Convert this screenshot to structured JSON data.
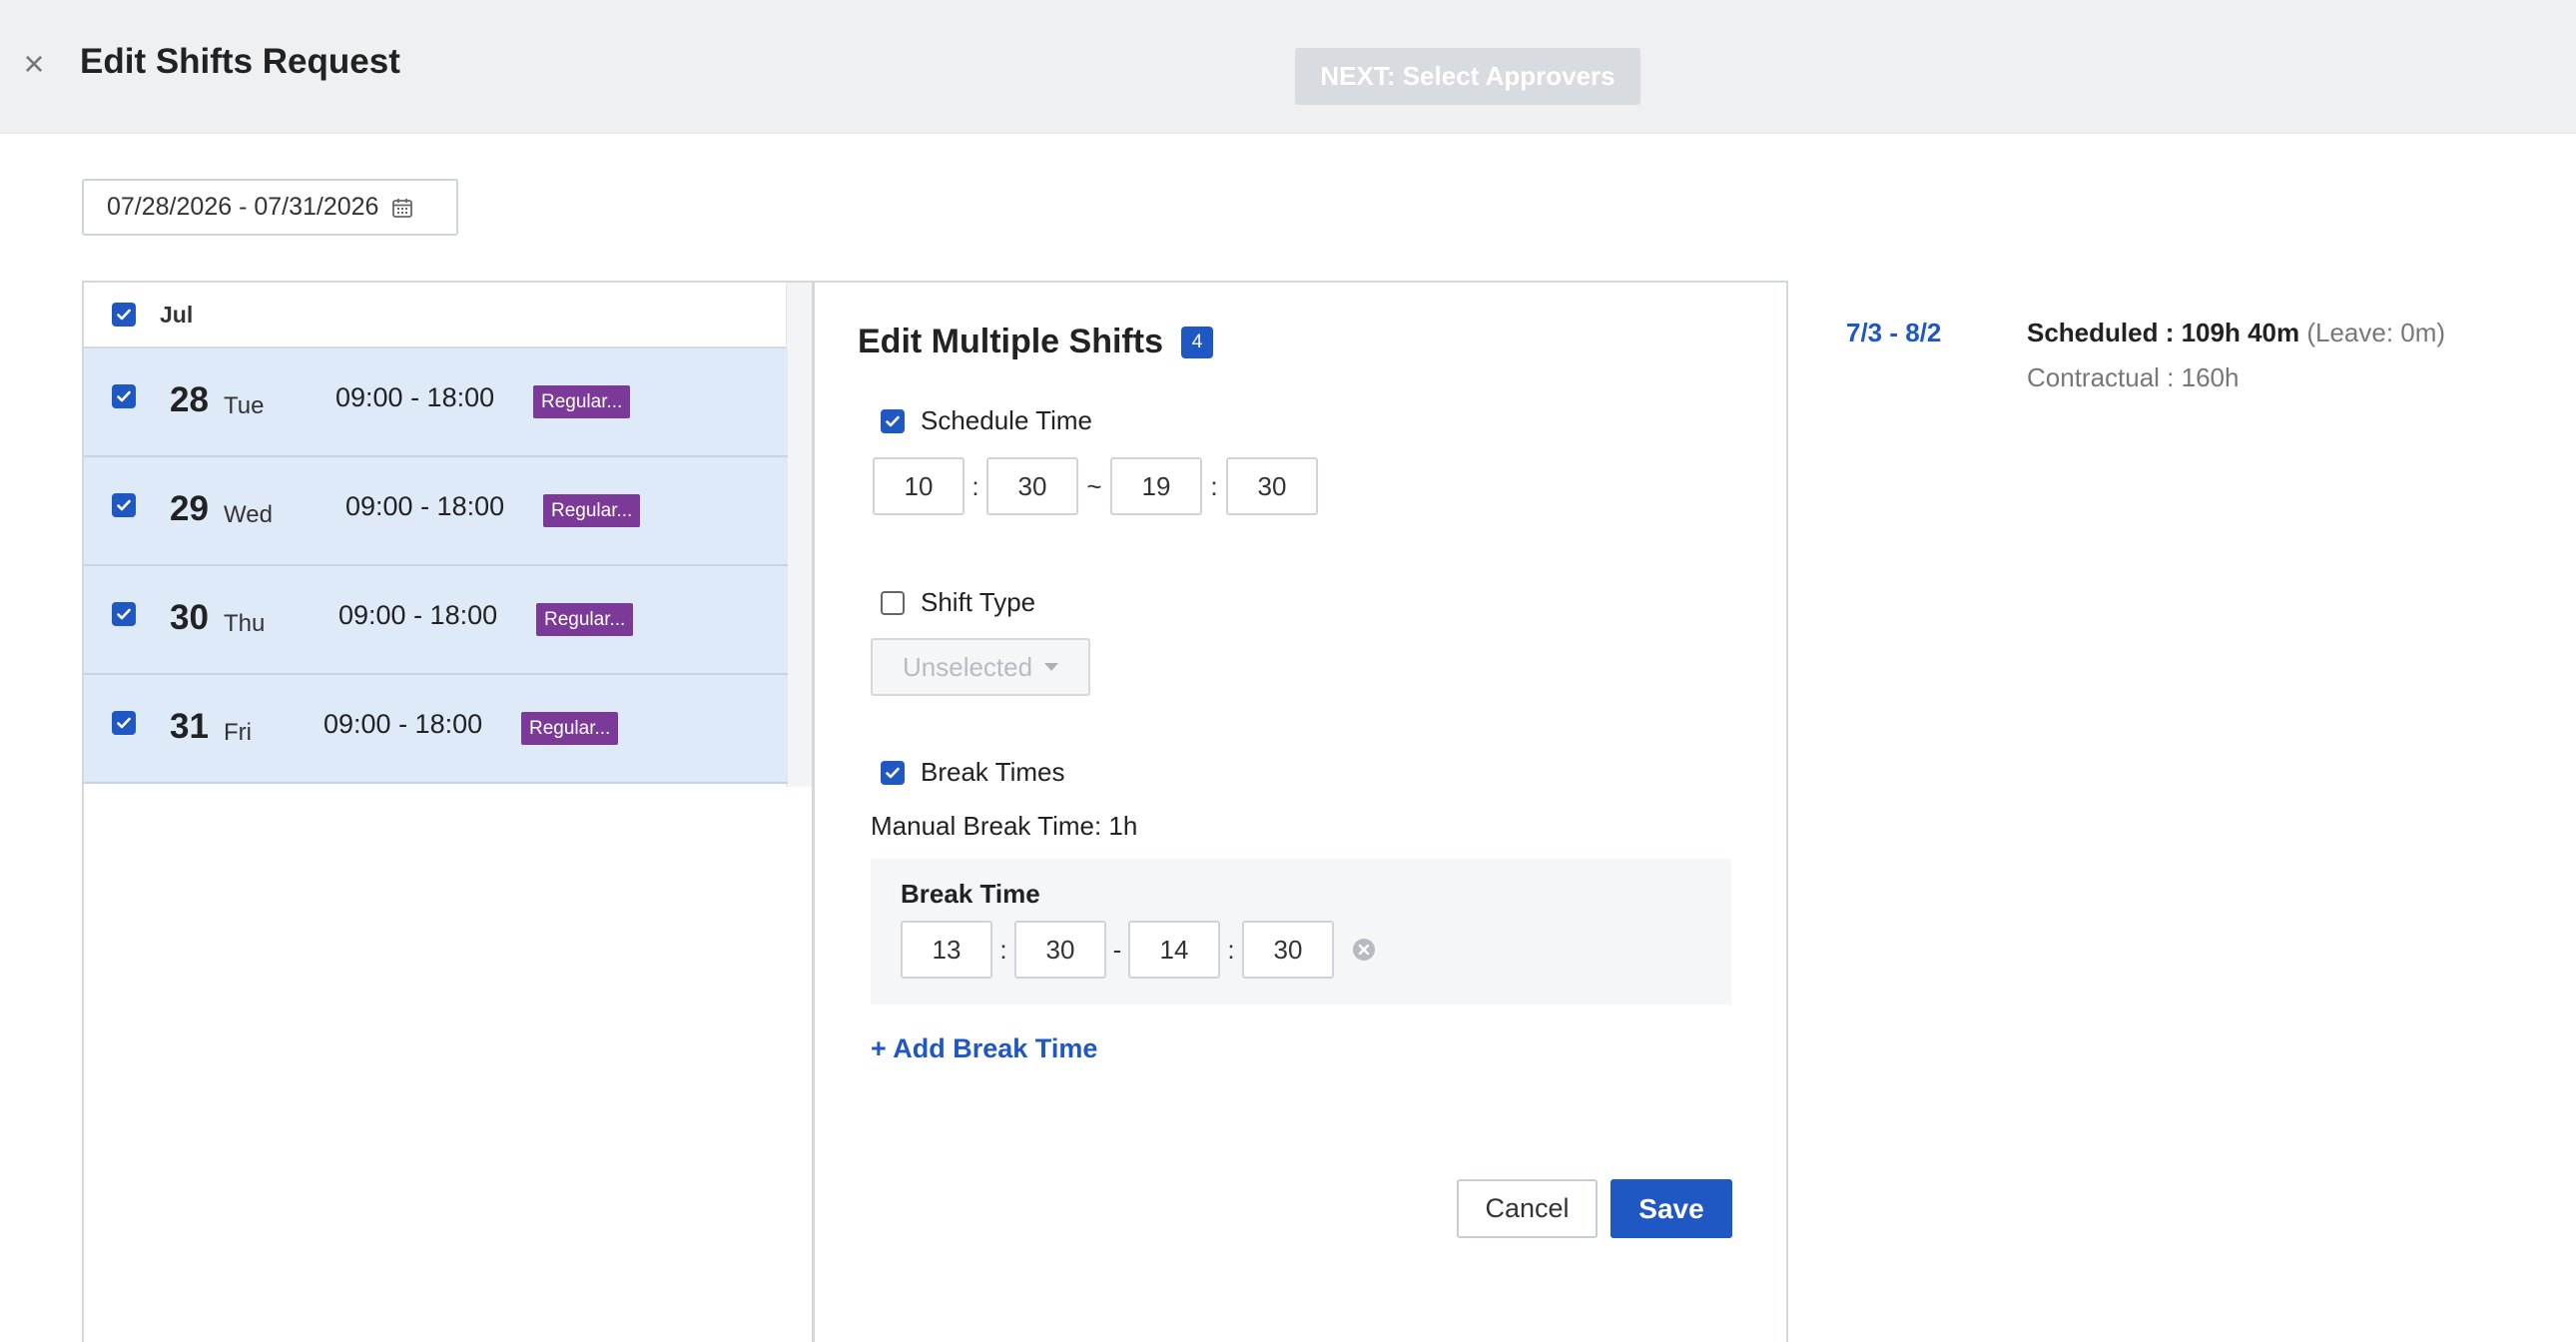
{
  "header": {
    "title": "Edit Shifts Request",
    "close_icon": "×",
    "next_button": "NEXT: Select Approvers"
  },
  "date_range": {
    "value": "07/28/2026 - 07/31/2026"
  },
  "list": {
    "month": "Jul",
    "rows": [
      {
        "day": "28",
        "weekday": "Tue",
        "time": "09:00 - 18:00",
        "badge": "Regular..."
      },
      {
        "day": "29",
        "weekday": "Wed",
        "time": "09:00 - 18:00",
        "badge": "Regular..."
      },
      {
        "day": "30",
        "weekday": "Thu",
        "time": "09:00 - 18:00",
        "badge": "Regular..."
      },
      {
        "day": "31",
        "weekday": "Fri",
        "time": "09:00 - 18:00",
        "badge": "Regular..."
      }
    ]
  },
  "edit": {
    "title": "Edit Multiple Shifts",
    "count": "4",
    "schedule_time": {
      "label": "Schedule Time",
      "checked": true,
      "start_h": "10",
      "start_m": "30",
      "end_h": "19",
      "end_m": "30",
      "colon": ":",
      "range_sep": "~"
    },
    "shift_type": {
      "label": "Shift Type",
      "checked": false,
      "selected": "Unselected"
    },
    "break_times": {
      "label": "Break Times",
      "checked": true,
      "manual": "Manual Break Time: 1h",
      "box_label": "Break Time",
      "start_h": "13",
      "start_m": "30",
      "end_h": "14",
      "end_m": "30",
      "colon": ":",
      "range_sep": "-"
    },
    "add_break": "+ Add Break Time",
    "cancel": "Cancel",
    "save": "Save"
  },
  "summary": {
    "period": "7/3 - 8/2",
    "scheduled_label": "Scheduled : ",
    "scheduled_value": "109h 40m",
    "leave": "(Leave: 0m)",
    "contractual": "Contractual : 160h"
  },
  "colors": {
    "accent": "#1f57c3",
    "badge": "#7b3a98",
    "row_bg": "#dfeaf9"
  }
}
